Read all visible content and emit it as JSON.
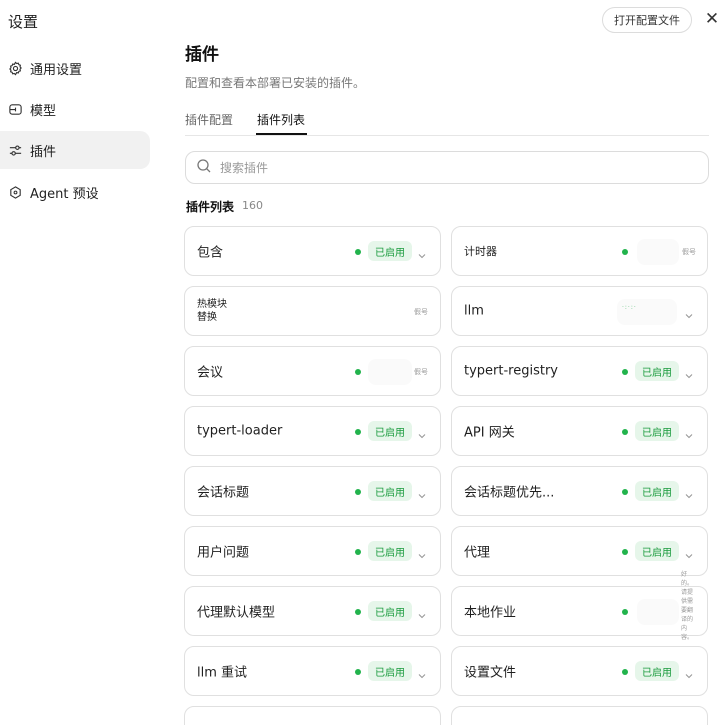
{
  "window": {
    "title": "设置",
    "open_config_label": "打开配置文件",
    "close_label": "✕"
  },
  "sidebar": {
    "items": [
      {
        "label": "通用设置",
        "icon": "gear-icon",
        "active": false
      },
      {
        "label": "模型",
        "icon": "model-icon",
        "active": false
      },
      {
        "label": "插件",
        "icon": "sliders-icon",
        "active": true
      },
      {
        "label": "Agent 预设",
        "icon": "agent-icon",
        "active": false
      }
    ]
  },
  "main": {
    "title": "插件",
    "description": "配置和查看本部署已安装的插件。",
    "tabs": [
      {
        "label": "插件配置",
        "active": false
      },
      {
        "label": "插件列表",
        "active": true
      }
    ],
    "search": {
      "placeholder": "搜索插件"
    },
    "list_heading": "插件列表",
    "list_count": "160"
  },
  "plugins": [
    {
      "name": "包含",
      "status": "已启用"
    },
    {
      "name": "计时器",
      "mini": "假号"
    },
    {
      "name": "热模块\n替换",
      "mini": "假号"
    },
    {
      "name": "llm"
    },
    {
      "name": "会议",
      "mini": "假号"
    },
    {
      "name": "typert-registry",
      "status": "已启用"
    },
    {
      "name": "typert-loader",
      "status": "已启用"
    },
    {
      "name": "API 网关",
      "status": "已启用"
    },
    {
      "name": "会话标题",
      "status": "已启用"
    },
    {
      "name": "会话标题优先...",
      "status": "已启用"
    },
    {
      "name": "用户问题",
      "status": "已启用"
    },
    {
      "name": "代理",
      "status": "已启用"
    },
    {
      "name": "代理默认模型",
      "status": "已启用"
    },
    {
      "name": "本地作业"
    },
    {
      "name": "llm 重试",
      "status": "已启用"
    },
    {
      "name": "设置文件",
      "status": "已启用"
    }
  ],
  "side_note": "好的。请提供需要翻译的内容。",
  "colors": {
    "accent_green": "#22b34c",
    "badge_bg": "#e6f6ea",
    "badge_text": "#1a9b3d"
  }
}
